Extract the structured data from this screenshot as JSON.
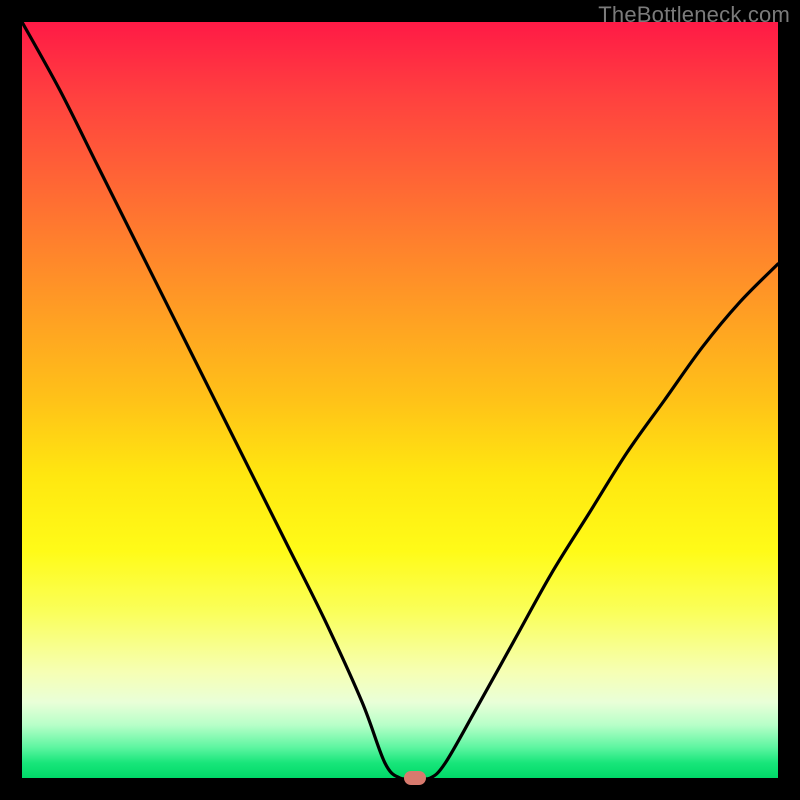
{
  "watermark": "TheBottleneck.com",
  "colors": {
    "border": "#000000",
    "curve": "#000000",
    "marker": "#d87a6e",
    "gradient_top": "#ff1a46",
    "gradient_bottom": "#00d868"
  },
  "chart_data": {
    "type": "line",
    "title": "",
    "xlabel": "",
    "ylabel": "",
    "xlim": [
      0,
      100
    ],
    "ylim": [
      0,
      100
    ],
    "series": [
      {
        "name": "bottleneck-curve",
        "x": [
          0,
          5,
          10,
          15,
          20,
          25,
          30,
          35,
          40,
          45,
          48,
          50,
          52,
          54,
          56,
          60,
          65,
          70,
          75,
          80,
          85,
          90,
          95,
          100
        ],
        "values": [
          100,
          91,
          81,
          71,
          61,
          51,
          41,
          31,
          21,
          10,
          2,
          0,
          0,
          0,
          2,
          9,
          18,
          27,
          35,
          43,
          50,
          57,
          63,
          68
        ]
      }
    ],
    "marker": {
      "x": 52,
      "y": 0
    },
    "annotations": []
  }
}
